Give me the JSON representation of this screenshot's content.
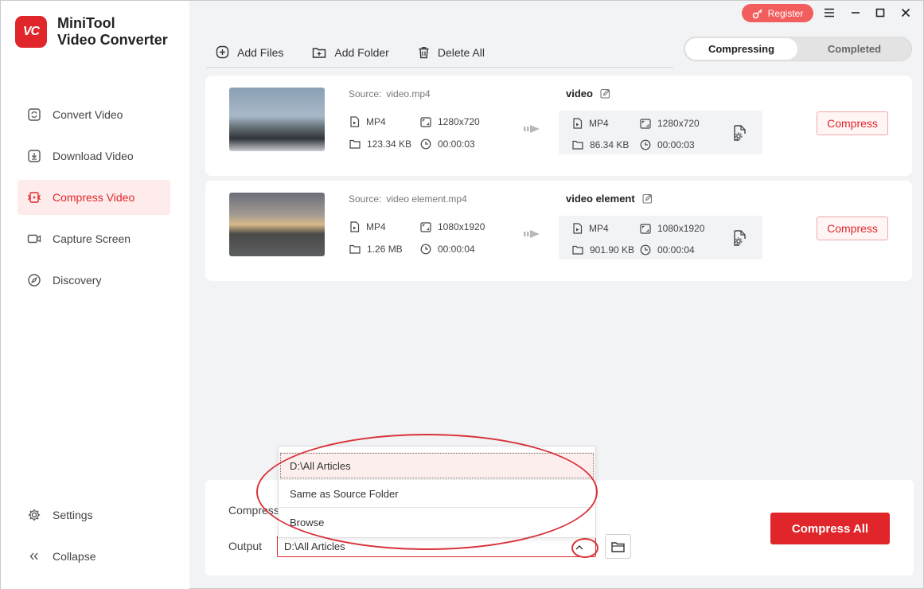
{
  "app": {
    "logo_badge": "VC",
    "name_line1": "MiniTool",
    "name_line2": "Video Converter",
    "brand_color": "#e0262a"
  },
  "topbar": {
    "register_label": "Register",
    "menu_icon": "hamburger-icon",
    "minimize_icon": "minimize-icon",
    "maximize_icon": "maximize-icon",
    "close_icon": "close-icon"
  },
  "sidebar": {
    "items": [
      {
        "label": "Convert Video",
        "icon": "convert-icon"
      },
      {
        "label": "Download Video",
        "icon": "download-icon"
      },
      {
        "label": "Compress Video",
        "icon": "compress-icon",
        "active": true
      },
      {
        "label": "Capture Screen",
        "icon": "camera-icon"
      },
      {
        "label": "Discovery",
        "icon": "compass-icon"
      }
    ],
    "bottom": [
      {
        "label": "Settings",
        "icon": "gear-icon"
      },
      {
        "label": "Collapse",
        "icon": "double-chevron-left-icon"
      }
    ]
  },
  "toolbar": {
    "add_files": "Add Files",
    "add_folder": "Add Folder",
    "delete_all": "Delete All"
  },
  "tabs": {
    "compressing": "Compressing",
    "completed": "Completed",
    "active": "Compressing"
  },
  "files": [
    {
      "source_label": "Source:",
      "source_name": "video.mp4",
      "format": "MP4",
      "resolution": "1280x720",
      "size": "123.34 KB",
      "duration": "00:00:03",
      "output_name": "video",
      "out_format": "MP4",
      "out_resolution": "1280x720",
      "out_size": "86.34 KB",
      "out_duration": "00:00:03",
      "compress_label": "Compress"
    },
    {
      "source_label": "Source:",
      "source_name": "video element.mp4",
      "format": "MP4",
      "resolution": "1080x1920",
      "size": "1.26 MB",
      "duration": "00:00:04",
      "output_name": "video element",
      "out_format": "MP4",
      "out_resolution": "1080x1920",
      "out_size": "901.90 KB",
      "out_duration": "00:00:04",
      "compress_label": "Compress"
    }
  ],
  "bottom_panel": {
    "compress_label": "Compress",
    "output_label": "Output",
    "output_value": "D:\\All Articles",
    "compress_all": "Compress All"
  },
  "output_dropdown": {
    "options": [
      "D:\\All Articles",
      "Same as Source Folder",
      "Browse"
    ],
    "selected": "D:\\All Articles"
  }
}
